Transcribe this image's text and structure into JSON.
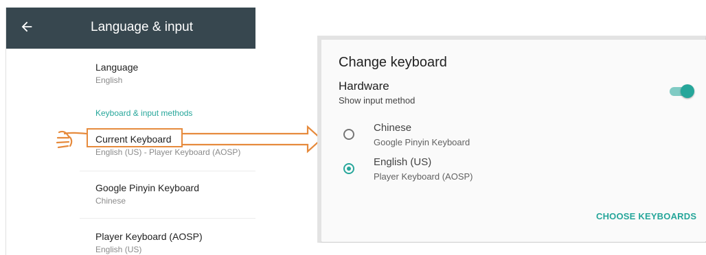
{
  "settings": {
    "title": "Language & input",
    "back_icon": "arrow-back-icon",
    "items": [
      {
        "title": "Language",
        "subtitle": "English"
      },
      {
        "title": "Current Keyboard",
        "subtitle": "English (US) - Player Keyboard (AOSP)"
      },
      {
        "title": "Google Pinyin Keyboard",
        "subtitle": "Chinese"
      },
      {
        "title": "Player Keyboard (AOSP)",
        "subtitle": "English (US)"
      }
    ],
    "section_header": "Keyboard & input methods"
  },
  "dialog": {
    "title": "Change keyboard",
    "hardware": {
      "title": "Hardware",
      "subtitle": "Show input method",
      "toggle_on": true
    },
    "options": [
      {
        "label": "Chinese",
        "subtitle": "Google Pinyin Keyboard",
        "selected": false
      },
      {
        "label": "English (US)",
        "subtitle": "Player Keyboard (AOSP)",
        "selected": true
      }
    ],
    "action": "CHOOSE KEYBOARDS"
  },
  "annotations": {
    "pointer_icon": "pointing-hand-icon",
    "arrow_icon": "right-arrow-icon"
  },
  "colors": {
    "accent": "#26a69a",
    "appbar": "#37474f",
    "annotation": "#e68a3c"
  }
}
